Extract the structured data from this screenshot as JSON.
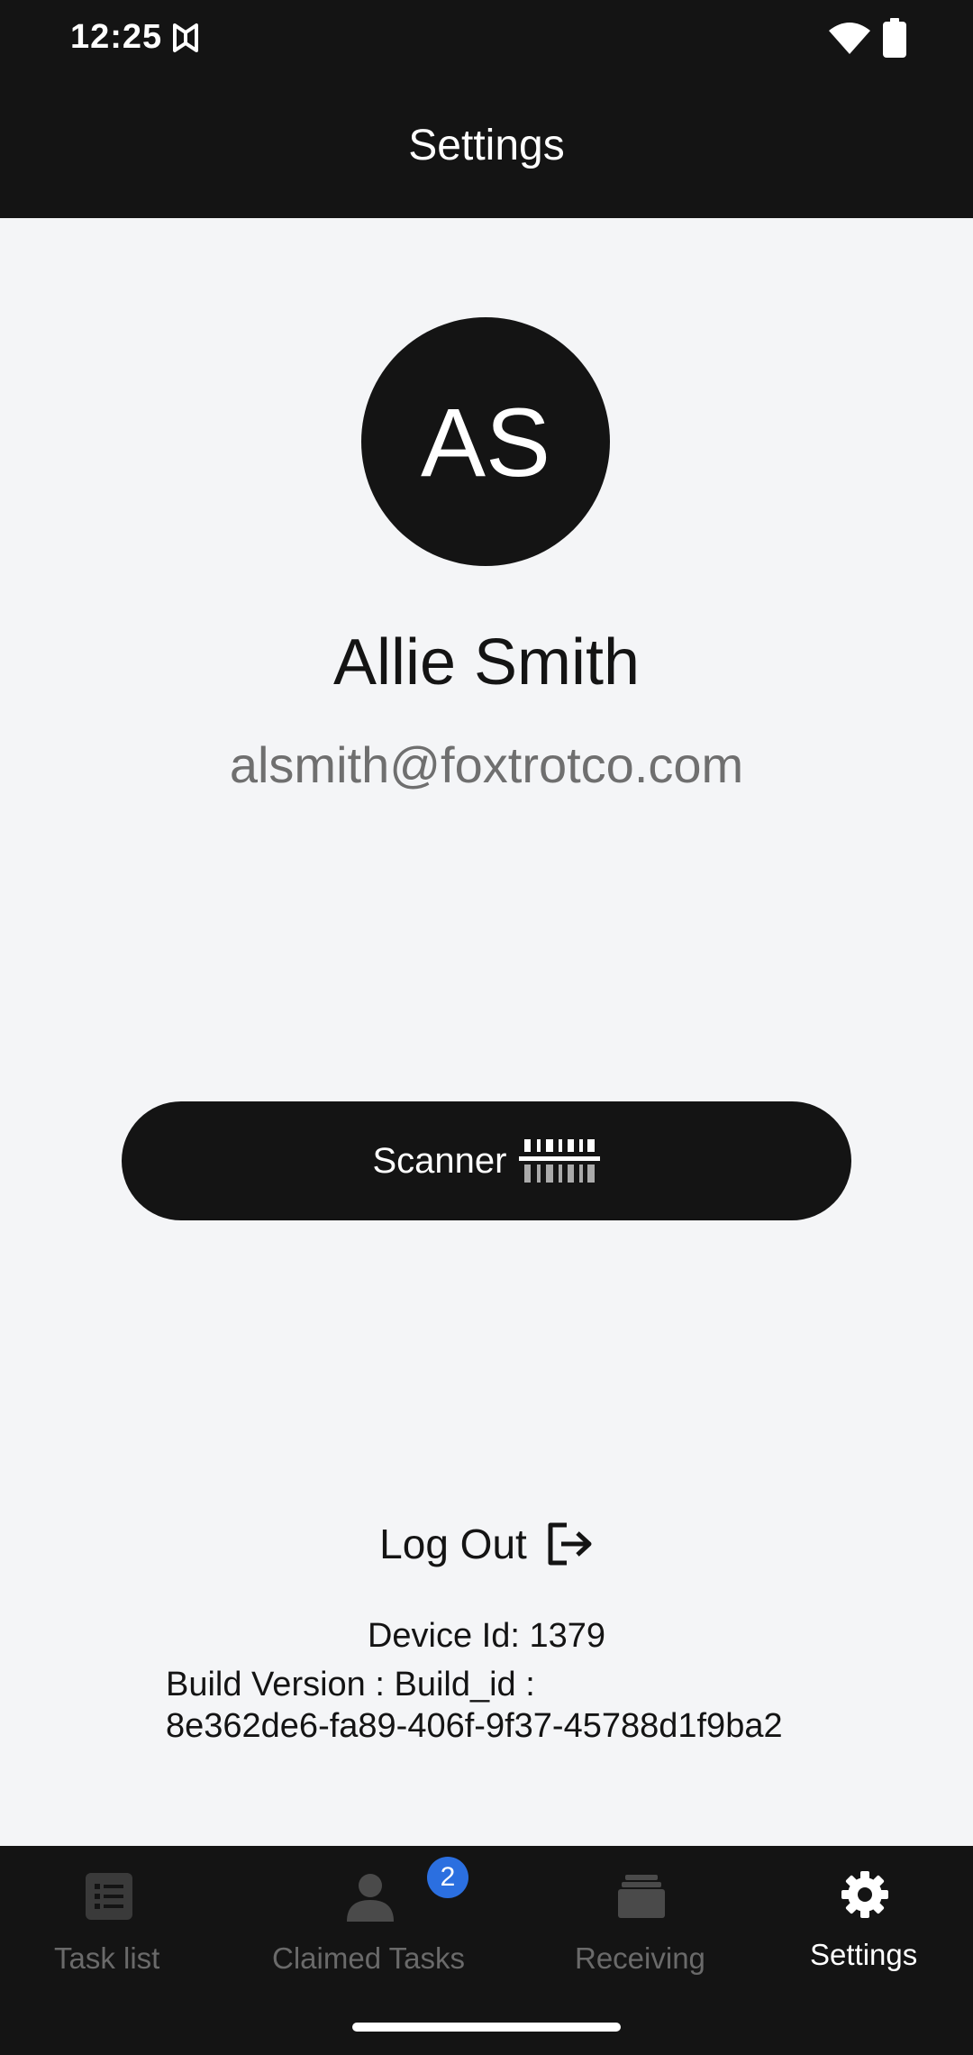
{
  "status_bar": {
    "time": "12:25",
    "app_icon": "notification-app-icon",
    "wifi_icon": "wifi-icon",
    "battery_icon": "battery-icon"
  },
  "app_bar": {
    "title": "Settings"
  },
  "profile": {
    "initials": "AS",
    "name": "Allie Smith",
    "email": "alsmith@foxtrotco.com"
  },
  "scanner_button": {
    "label": "Scanner",
    "icon": "barcode-scanner-icon"
  },
  "logout": {
    "label": "Log Out",
    "icon": "logout-icon"
  },
  "device_info": {
    "device_id": "Device Id: 1379",
    "build_version_line1": "Build Version : Build_id :",
    "build_version_line2": "8e362de6-fa89-406f-9f37-45788d1f9ba2"
  },
  "bottom_nav": {
    "items": [
      {
        "label": "Task list",
        "icon": "task-list-icon",
        "active": false
      },
      {
        "label": "Claimed Tasks",
        "icon": "person-icon",
        "active": false,
        "badge": "2"
      },
      {
        "label": "Receiving",
        "icon": "stack-icon",
        "active": false
      },
      {
        "label": "Settings",
        "icon": "gear-icon",
        "active": true
      }
    ]
  },
  "colors": {
    "bar_background": "#141414",
    "page_background": "#f4f5f7",
    "badge": "#2b6fe0",
    "inactive_nav": "#6a6a6a",
    "email_text": "#6f6f6f"
  }
}
